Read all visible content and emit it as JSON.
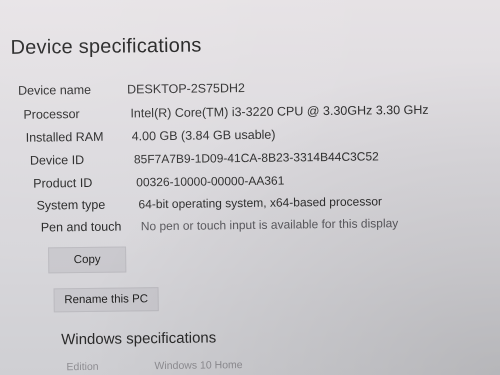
{
  "page": {
    "title": "Device specifications"
  },
  "specs": [
    {
      "label": "Device name",
      "value": "DESKTOP-2S75DH2"
    },
    {
      "label": "Processor",
      "value": "Intel(R) Core(TM) i3-3220 CPU @ 3.30GHz   3.30 GHz"
    },
    {
      "label": "Installed RAM",
      "value": "4.00 GB (3.84 GB usable)"
    },
    {
      "label": "Device ID",
      "value": "85F7A7B9-1D09-41CA-8B23-3314B44C3C52"
    },
    {
      "label": "Product ID",
      "value": "00326-10000-00000-AA361"
    },
    {
      "label": "System type",
      "value": "64-bit operating system, x64-based processor"
    },
    {
      "label": "Pen and touch",
      "value": "No pen or touch input is available for this display"
    }
  ],
  "buttons": {
    "copy": "Copy",
    "rename": "Rename this PC"
  },
  "windows": {
    "title": "Windows specifications",
    "edition_label": "Edition",
    "edition_value": "Windows 10 Home"
  }
}
